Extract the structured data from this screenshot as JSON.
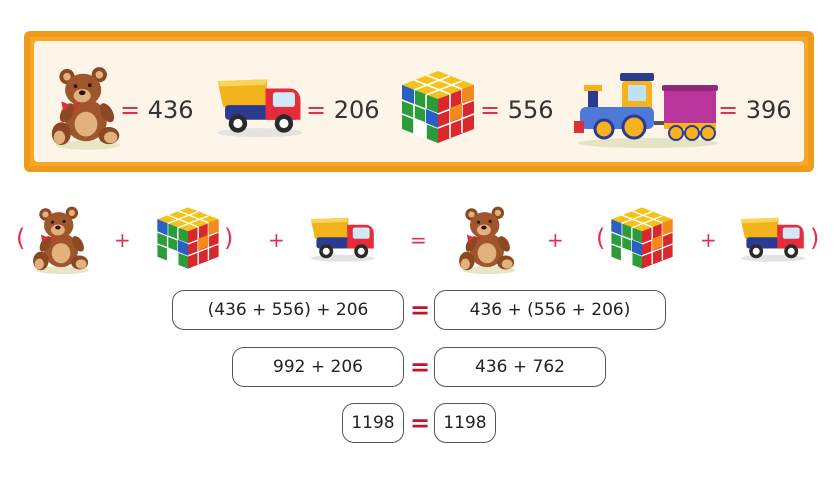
{
  "legend": {
    "items": [
      {
        "toy": "teddy-bear",
        "equals": "=",
        "value": "436"
      },
      {
        "toy": "dump-truck",
        "equals": "=",
        "value": "206"
      },
      {
        "toy": "rubiks-cube",
        "equals": "=",
        "value": "556"
      },
      {
        "toy": "toy-train",
        "equals": "=",
        "value": "396"
      }
    ]
  },
  "expression": {
    "open_paren_left": "(",
    "plus1": "+",
    "close_paren_left": ")",
    "plus2": "+",
    "equals": "=",
    "plus3": "+",
    "open_paren_right": "(",
    "plus4": "+",
    "close_paren_right": ")"
  },
  "steps": [
    {
      "left": "(436 + 556) + 206",
      "equals": "=",
      "right": "436 + (556 + 206)"
    },
    {
      "left": "992 + 206",
      "equals": "=",
      "right": "436 + 762"
    },
    {
      "left": "1198",
      "equals": "=",
      "right": "1198"
    }
  ],
  "colors": {
    "accent": "#e0314b",
    "frame": "#f09a1a",
    "panel": "#fdf5e7"
  }
}
